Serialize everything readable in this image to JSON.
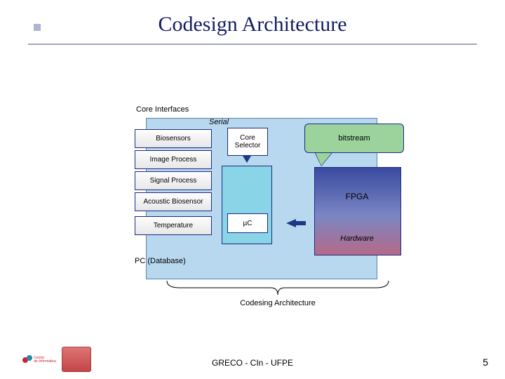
{
  "title": "Codesign Architecture",
  "core_interfaces_label": "Core Interfaces",
  "serial_label": "Serial",
  "buttons": {
    "biosensors": "Biosensors",
    "image_process": "Image Process",
    "signal_process": "Signal Process",
    "acoustic_biosensor": "Acoustic Biosensor",
    "temperature": "Temperature"
  },
  "core_selector": "Core\nSelector",
  "uc_label": "µC",
  "bitstream": "bitstream",
  "fpga": "FPGA",
  "hardware": "Hardware",
  "pc_database": "PC (Database)",
  "brace_caption": "Codesing Architecture",
  "footer": "GRECO - CIn - UFPE",
  "page_number": "5"
}
